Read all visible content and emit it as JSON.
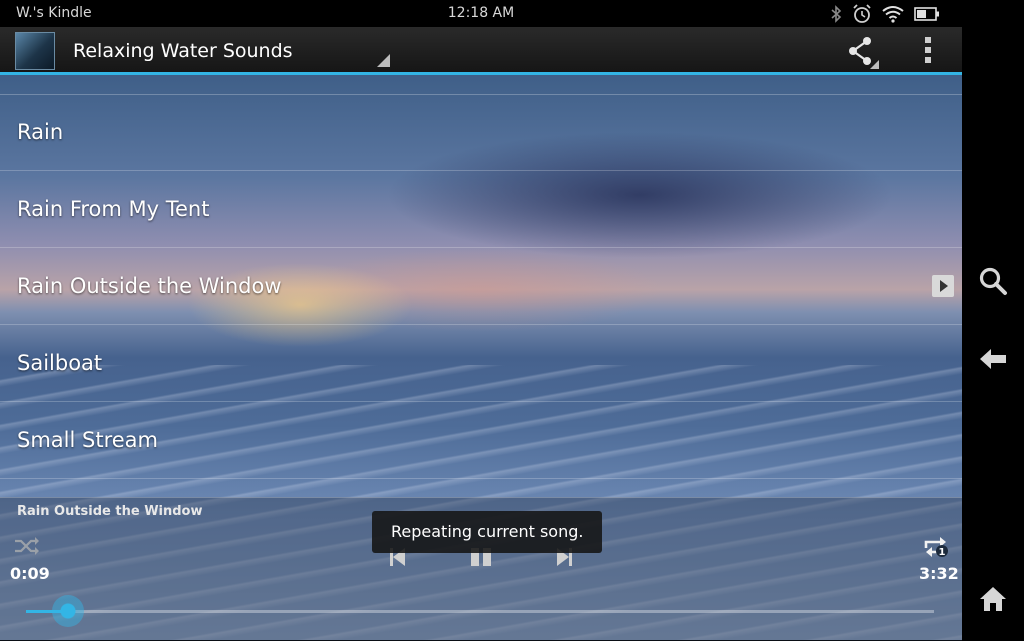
{
  "status_bar": {
    "device_name": "W.'s Kindle",
    "time": "12:18 AM"
  },
  "action_bar": {
    "title": "Relaxing Water Sounds"
  },
  "tracks": [
    {
      "label": "Rain"
    },
    {
      "label": "Rain From My Tent"
    },
    {
      "label": "Rain Outside the Window",
      "now_playing": true
    },
    {
      "label": "Sailboat"
    },
    {
      "label": "Small Stream"
    }
  ],
  "player": {
    "now_playing_title": "Rain Outside the Window",
    "elapsed": "0:09",
    "total": "3:32",
    "progress_fraction": 0.046,
    "repeat_badge": "1"
  },
  "toast": {
    "message": "Repeating current song."
  },
  "colors": {
    "accent": "#33b5e5",
    "status_bg": "#000000",
    "action_bar_bg": "#1f1f1f"
  },
  "icons": {
    "status": [
      "bluetooth-icon",
      "alarm-icon",
      "wifi-icon",
      "battery-icon"
    ],
    "action": [
      "share-icon",
      "overflow-menu-icon"
    ],
    "player": [
      "shuffle-icon",
      "repeat-one-icon",
      "previous-icon",
      "pause-icon",
      "next-icon"
    ],
    "nav": [
      "search-icon",
      "back-icon",
      "home-icon"
    ]
  }
}
